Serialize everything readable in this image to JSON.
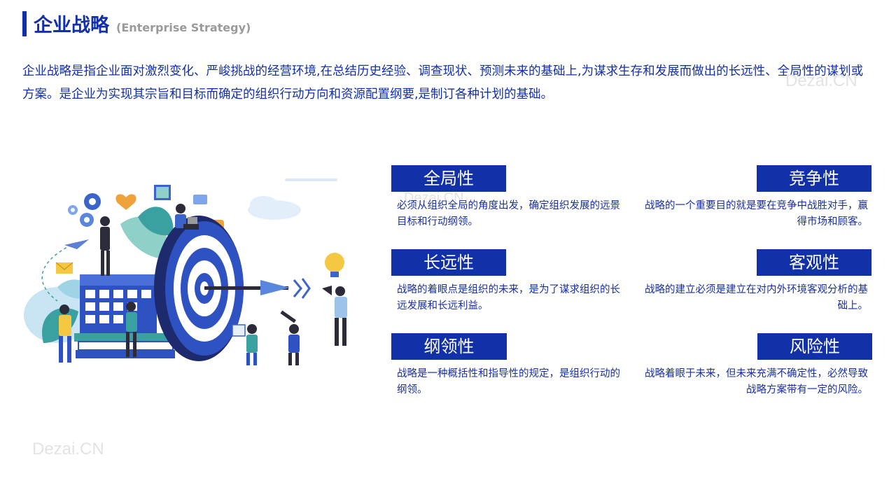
{
  "header": {
    "title": "企业战略",
    "subtitle": "(Enterprise  Strategy)"
  },
  "intro": "企业战略是指企业面对激烈变化、严峻挑战的经营环境,在总结历史经验、调查现状、预测未来的基础上,为谋求生存和发展而做出的长远性、全局性的谋划或方案。是企业为实现其宗旨和目标而确定的组织行动方向和资源配置纲要,是制订各种计划的基础。",
  "watermark": "Dezai.CN",
  "features": [
    {
      "label": "全局性",
      "desc": "必须从组织全局的角度出发，确定组织发展的远景目标和行动纲领。"
    },
    {
      "label": "竞争性",
      "desc": "战略的一个重要目的就是要在竞争中战胜对手，赢得市场和顾客。"
    },
    {
      "label": "长远性",
      "desc": "战略的着眼点是组织的未来，是为了谋求组织的长远发展和长远利益。"
    },
    {
      "label": "客观性",
      "desc": "战略的建立必须是建立在对内外环境客观分析的基础上。"
    },
    {
      "label": "纲领性",
      "desc": "战略是一种概括性和指导性的规定，是组织行动的纲领。"
    },
    {
      "label": "风险性",
      "desc": "战略着眼于未来，但未来充满不确定性，必然导致战略方案带有一定的风险。"
    }
  ],
  "colors": {
    "brand_blue": "#1230a8",
    "teal": "#3aa0a0",
    "yellow": "#f5c842",
    "light_blue": "#9ec3ea"
  }
}
